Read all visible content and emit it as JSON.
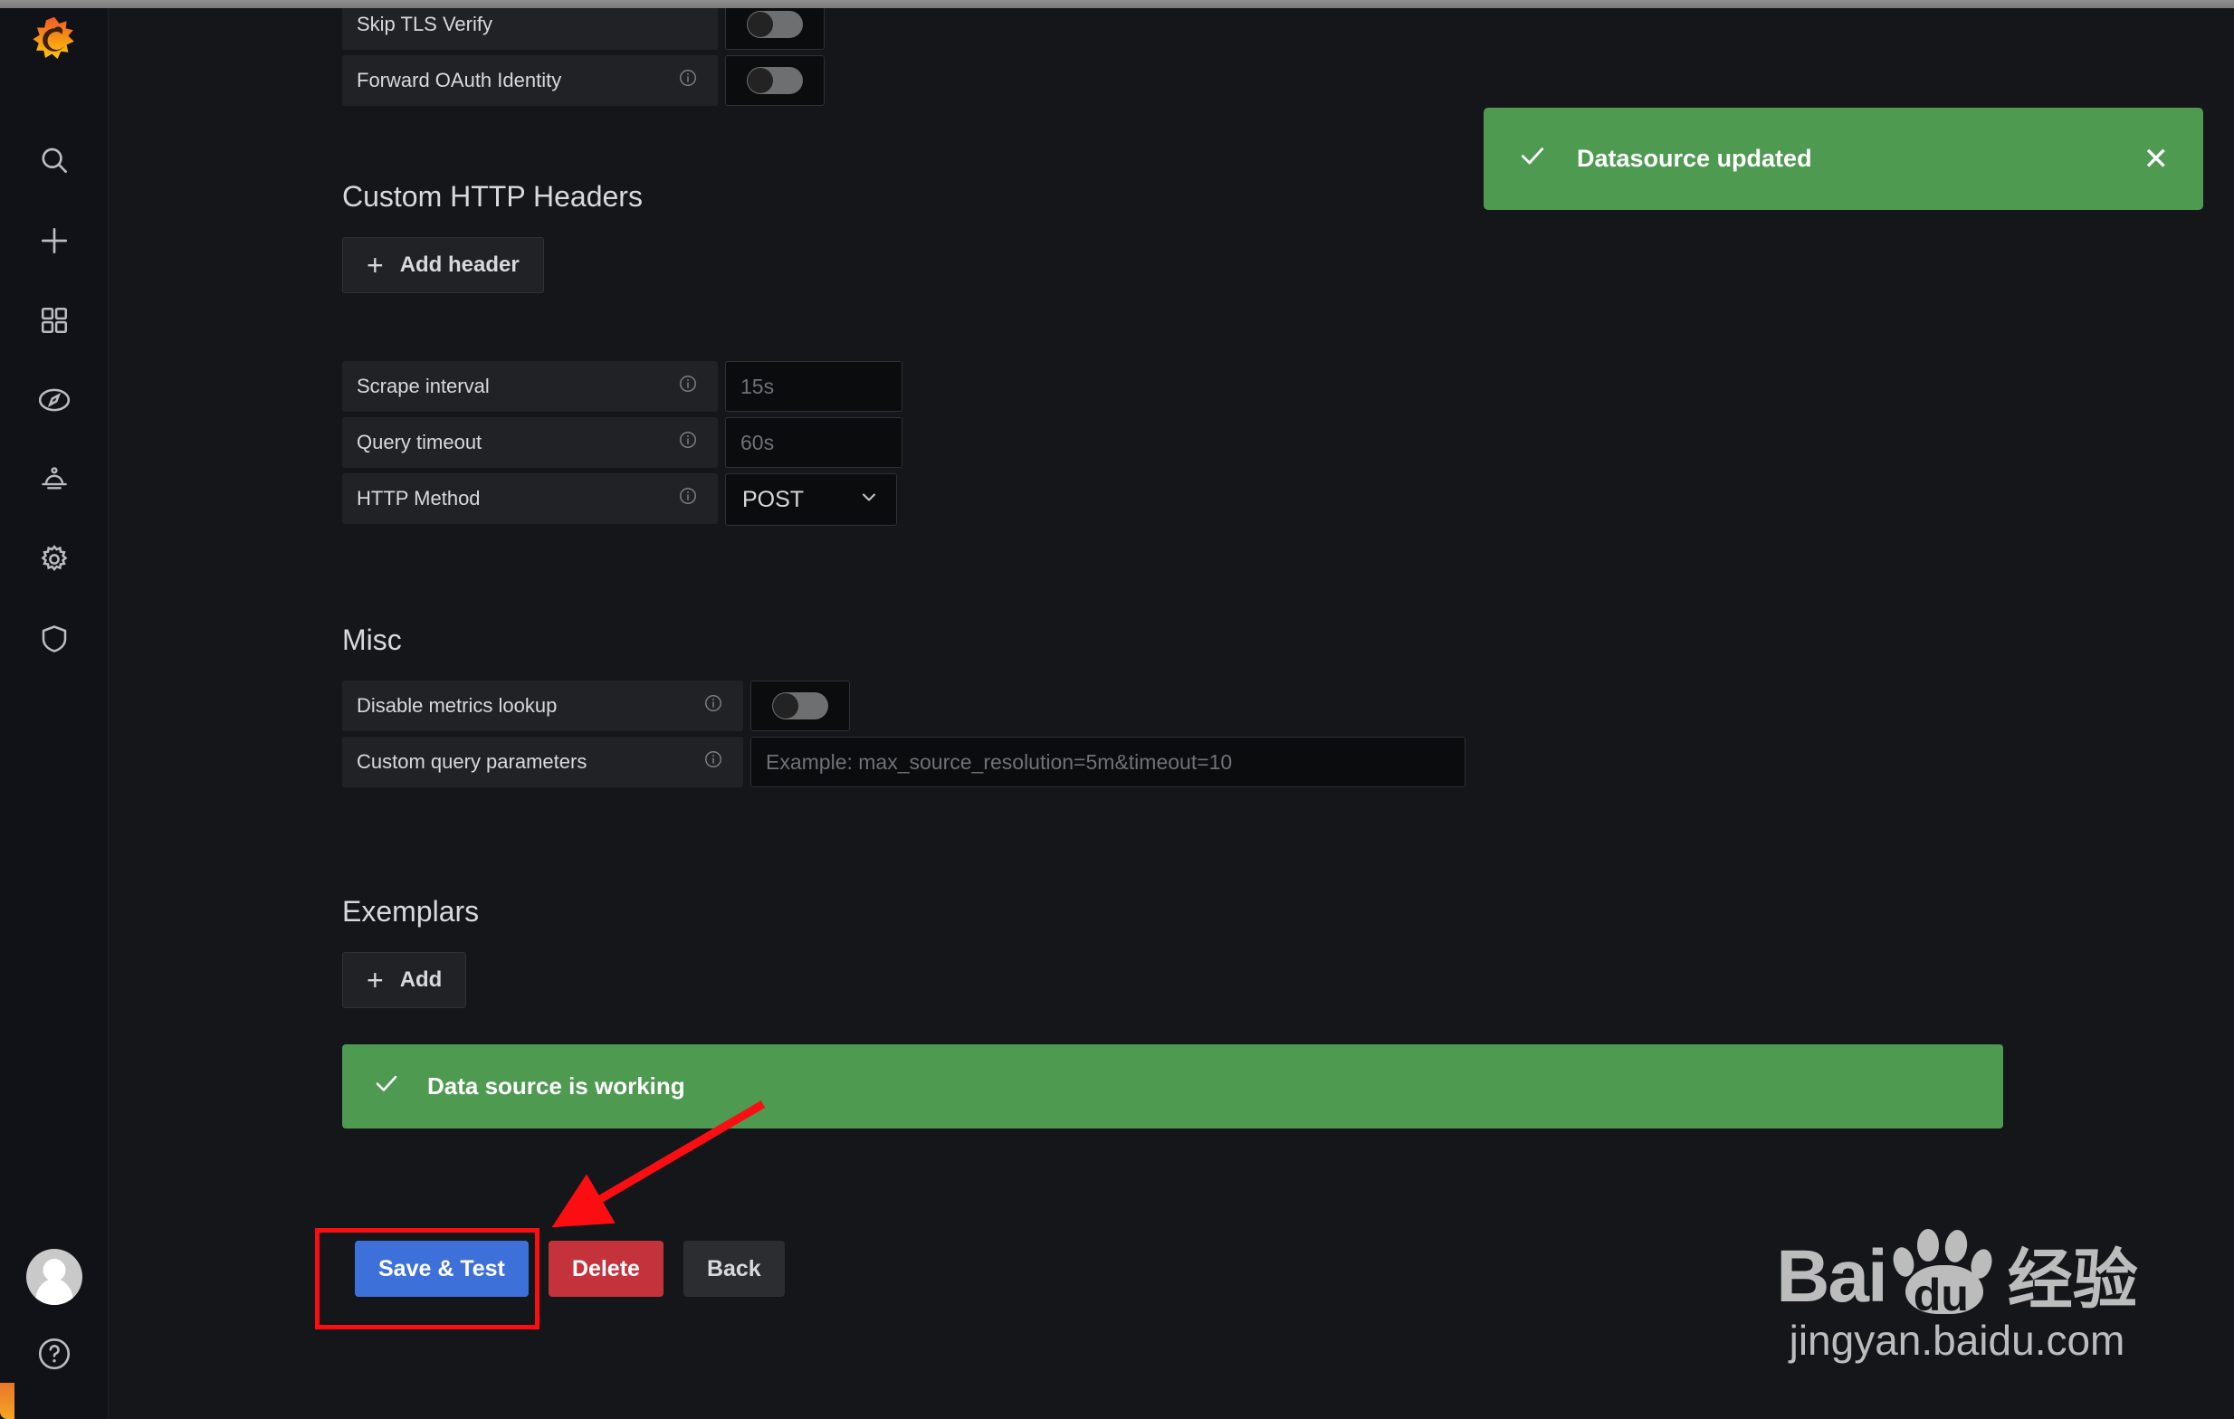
{
  "app": {
    "name": "Grafana",
    "logo_icon": "grafana-logo-icon"
  },
  "sidebar": {
    "items": [
      {
        "name": "search",
        "icon": "search-icon"
      },
      {
        "name": "create",
        "icon": "plus-icon"
      },
      {
        "name": "dashboards",
        "icon": "dashboards-grid-icon"
      },
      {
        "name": "explore",
        "icon": "compass-icon"
      },
      {
        "name": "alerting",
        "icon": "bell-icon"
      },
      {
        "name": "configuration",
        "icon": "gear-icon"
      },
      {
        "name": "server-admin",
        "icon": "shield-icon"
      }
    ],
    "bottom": {
      "avatar_icon": "user-avatar-icon",
      "help_icon": "question-circle-icon"
    }
  },
  "toast": {
    "check_icon": "check-icon",
    "message": "Datasource updated",
    "close_label": "✕",
    "color": "#4e9a51"
  },
  "form": {
    "auth_fields": [
      {
        "label": "Skip TLS Verify",
        "has_info": false,
        "toggle": "off"
      },
      {
        "label": "Forward OAuth Identity",
        "has_info": true,
        "toggle": "off"
      }
    ],
    "custom_headers": {
      "title": "Custom HTTP Headers",
      "add_button": "Add header",
      "plus_icon": "plus-icon"
    },
    "interval_fields": [
      {
        "label": "Scrape interval",
        "has_info": true,
        "value": "",
        "placeholder": "15s"
      },
      {
        "label": "Query timeout",
        "has_info": true,
        "value": "",
        "placeholder": "60s"
      }
    ],
    "http_method": {
      "label": "HTTP Method",
      "has_info": true,
      "selected": "POST",
      "chevron_icon": "chevron-down-icon"
    },
    "misc": {
      "title": "Misc",
      "disable_metrics_lookup": {
        "label": "Disable metrics lookup",
        "has_info": true,
        "toggle": "off"
      },
      "custom_query_parameters": {
        "label": "Custom query parameters",
        "has_info": true,
        "value": "",
        "placeholder": "Example: max_source_resolution=5m&timeout=10"
      }
    },
    "exemplars": {
      "title": "Exemplars",
      "add_button": "Add",
      "plus_icon": "plus-icon"
    }
  },
  "test_result": {
    "check_icon": "check-icon",
    "message": "Data source is working",
    "color": "#4e9a51"
  },
  "actions": {
    "save_test": "Save & Test",
    "delete": "Delete",
    "back": "Back",
    "primary_color": "#3d71d9",
    "danger_color": "#c4333c"
  },
  "annotation": {
    "highlight_color": "#fb0d12",
    "target": "Save & Test"
  },
  "watermark": {
    "brand": "Bai",
    "paw_label": "du",
    "cn_text": "经验",
    "url": "jingyan.baidu.com"
  }
}
